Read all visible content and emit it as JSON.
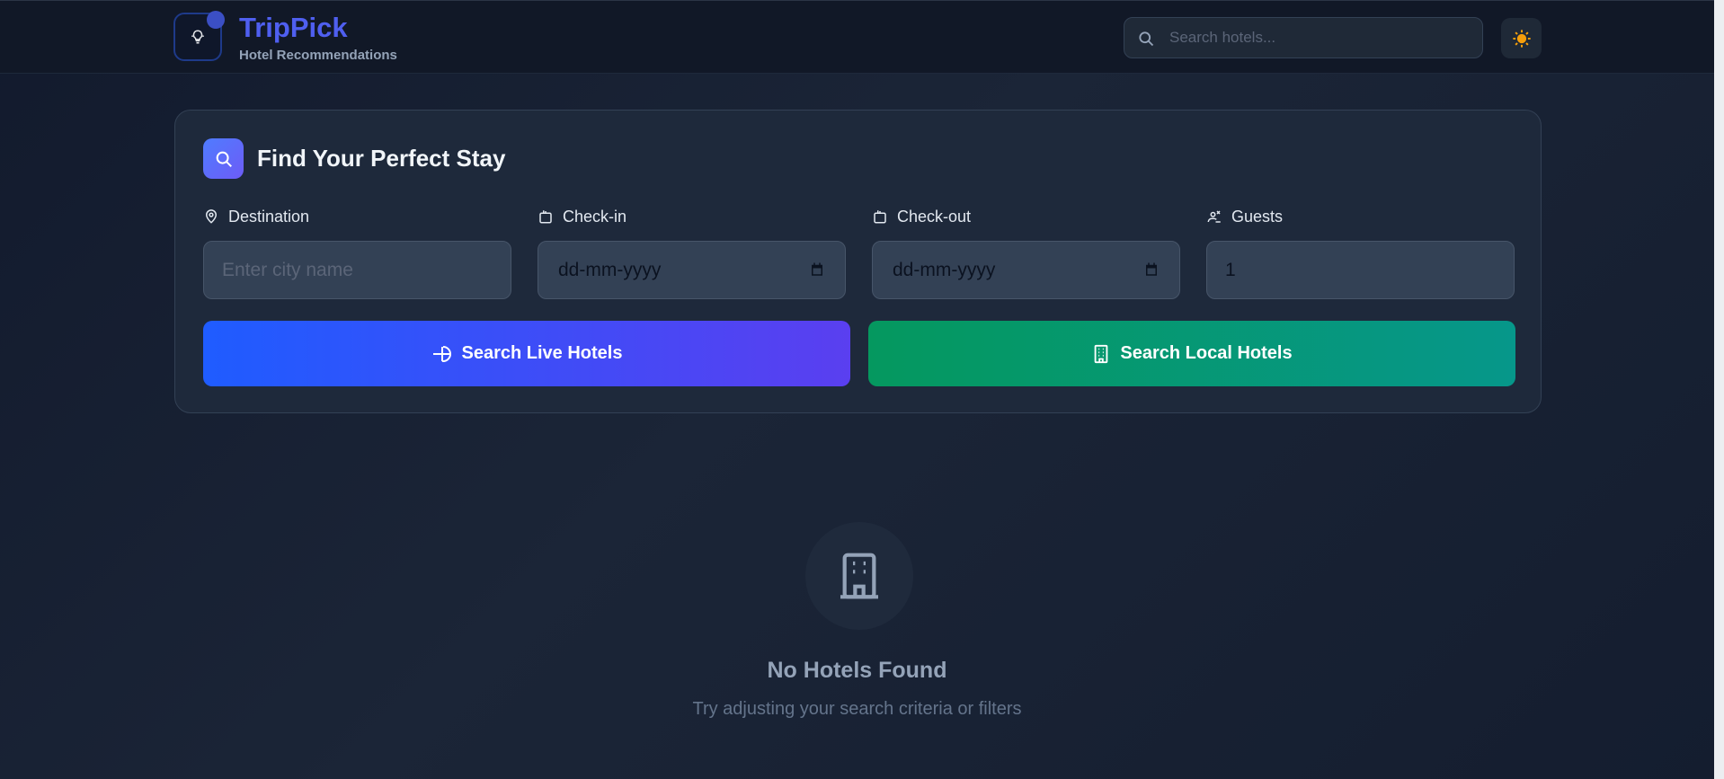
{
  "header": {
    "brand_title": "TripPick",
    "brand_subtitle": "Hotel Recommendations",
    "search_placeholder": "Search hotels...",
    "logo_icon": "lightbulb-icon",
    "theme_icon": "sun-icon"
  },
  "search_panel": {
    "title": "Find Your Perfect Stay",
    "fields": {
      "destination": {
        "label": "Destination",
        "placeholder": "Enter city name",
        "icon": "map-pin-icon"
      },
      "checkin": {
        "label": "Check-in",
        "value": "dd-mm-yyyy",
        "icon": "calendar-icon"
      },
      "checkout": {
        "label": "Check-out",
        "value": "dd-mm-yyyy",
        "icon": "calendar-icon"
      },
      "guests": {
        "label": "Guests",
        "value": "1",
        "icon": "guests-icon"
      }
    },
    "buttons": {
      "live": "Search Live Hotels",
      "local": "Search Local Hotels"
    }
  },
  "empty_state": {
    "title": "No Hotels Found",
    "subtitle": "Try adjusting your search criteria or filters",
    "icon": "building-icon"
  },
  "colors": {
    "background": "#1b2537",
    "brand": "#4f5ff0",
    "live_button": "#1f5cff",
    "local_button": "#05985f",
    "sun": "#f59e0b"
  }
}
